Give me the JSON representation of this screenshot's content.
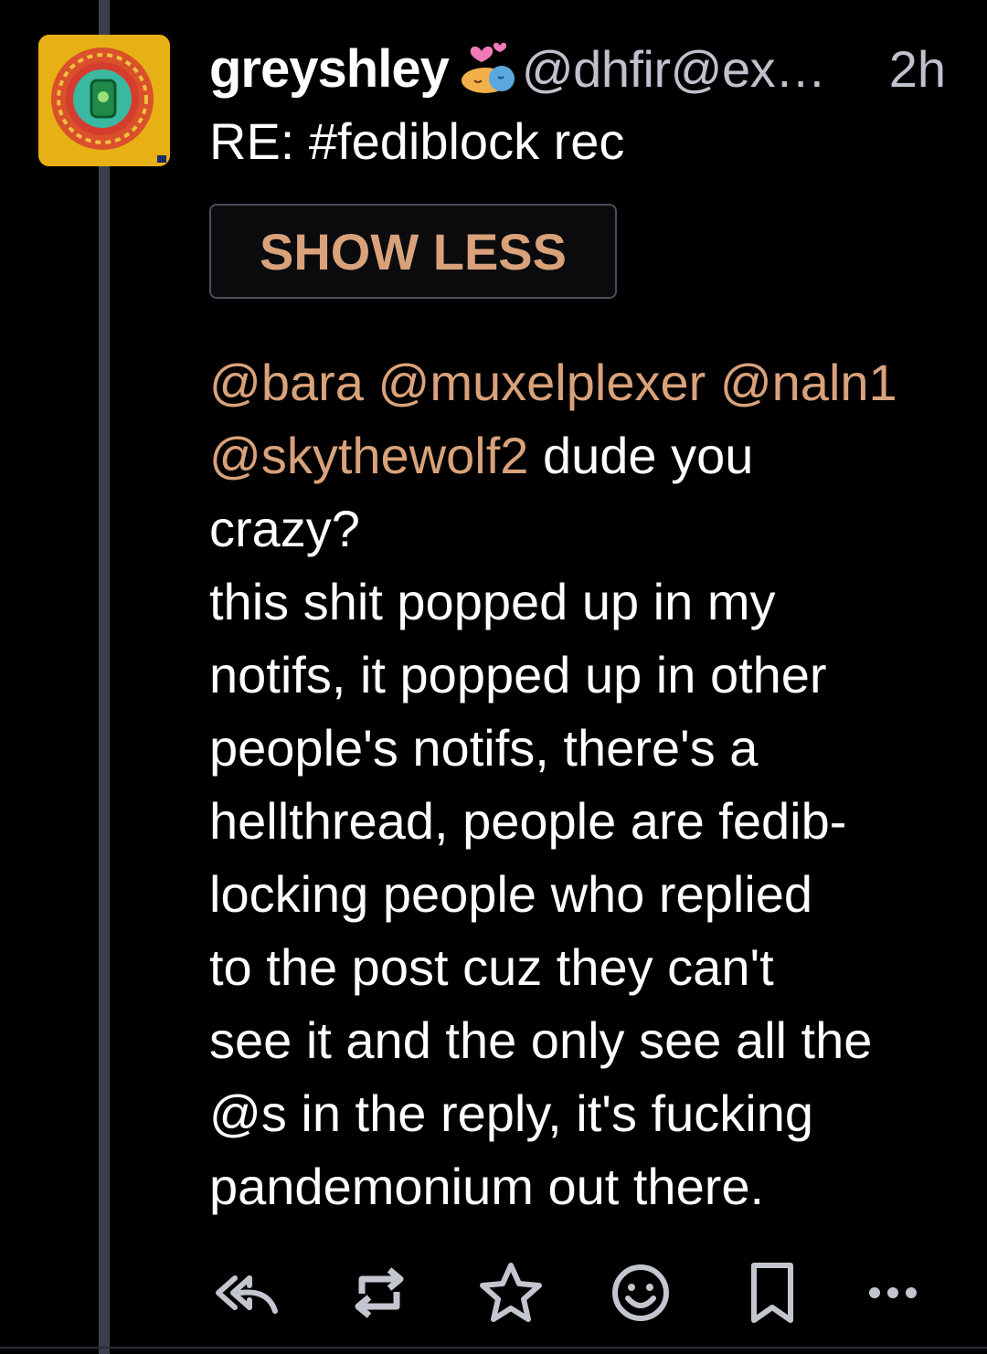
{
  "post": {
    "display_name": "greyshley",
    "handle": "@dhfir@ex…",
    "time": "2h",
    "subject": "RE: #fediblock rec",
    "show_less_label": "SHOW LESS",
    "mentions_line1": [
      "@bara",
      "@muxelplexer",
      "@naln1"
    ],
    "mention_line2": "@skythewolf2",
    "text_after_mentions": " dude you",
    "body_text": "crazy?\nthis shit popped up in my\nnotifs, it popped up in other\npeople's notifs, there's a\nhellthread, people are fedib-\nlocking people who replied\nto the post cuz they can't\nsee it and the only see all the\n@s in the reply, it's fucking\npandemonium out there."
  },
  "actions": {
    "reply_icon": "reply-all-icon",
    "boost_icon": "boost-icon",
    "favorite_icon": "star-icon",
    "react_icon": "emoji-smile-icon",
    "bookmark_icon": "bookmark-icon",
    "more_icon": "more-icon"
  },
  "colors": {
    "background": "#000000",
    "accent": "#d9a27a",
    "text": "#ffffff",
    "muted": "#bfc2cc",
    "thread_line": "#3b3f4b"
  }
}
